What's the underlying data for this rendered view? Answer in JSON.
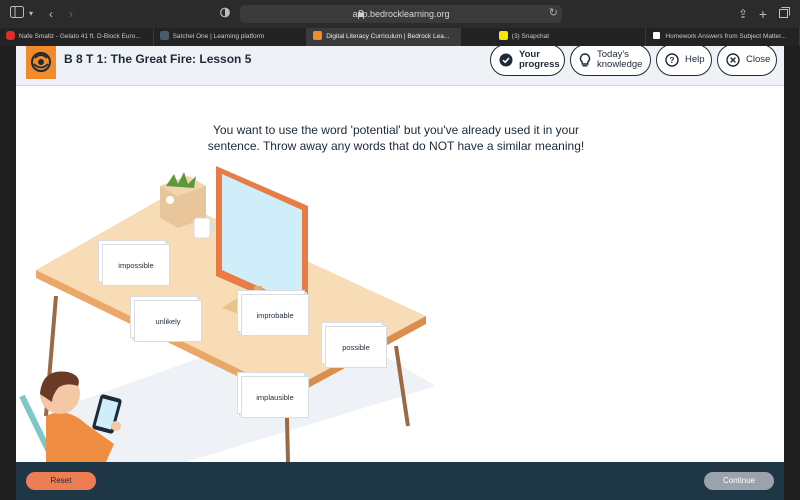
{
  "browser": {
    "url": "app.bedrocklearning.org",
    "tabs": [
      {
        "label": "Nafe Smallz - Gelato 41 ft. D-Block Euro...",
        "icon": "youtube-icon",
        "color": "#e02b2b"
      },
      {
        "label": "Satchel One | Learning platform",
        "icon": "satchel-icon",
        "color": "#4a5a6a"
      },
      {
        "label": "Digital Literacy Curriculum | Bedrock Lea...",
        "icon": "bedrock-icon",
        "color": "#f08a2a",
        "active": true
      },
      {
        "label": "(3) Snapchat",
        "icon": "snapchat-icon",
        "color": "#f7e600"
      },
      {
        "label": "Homework Answers from Subject Matter...",
        "icon": "studyx-icon",
        "color": "#ffffff"
      }
    ]
  },
  "header": {
    "title": "B 8 T 1: The Great Fire: Lesson 5",
    "buttons": {
      "progress_line1": "Your",
      "progress_line2": "progress",
      "knowledge_line1": "Today's",
      "knowledge_line2": "knowledge",
      "help": "Help",
      "close": "Close"
    }
  },
  "instruction": {
    "line1": "You want to use the word 'potential' but you've already used it in your",
    "line2": "sentence. Throw away any words that do NOT have a similar meaning!"
  },
  "cards": [
    "impossible",
    "unlikely",
    "improbable",
    "possible",
    "implausible"
  ],
  "footer": {
    "reset": "Reset",
    "continue": "Continue"
  },
  "colors": {
    "accent": "#ef7d54",
    "navy": "#1d2a38",
    "footer": "#1e3646",
    "disabled": "#9aa3ab"
  }
}
